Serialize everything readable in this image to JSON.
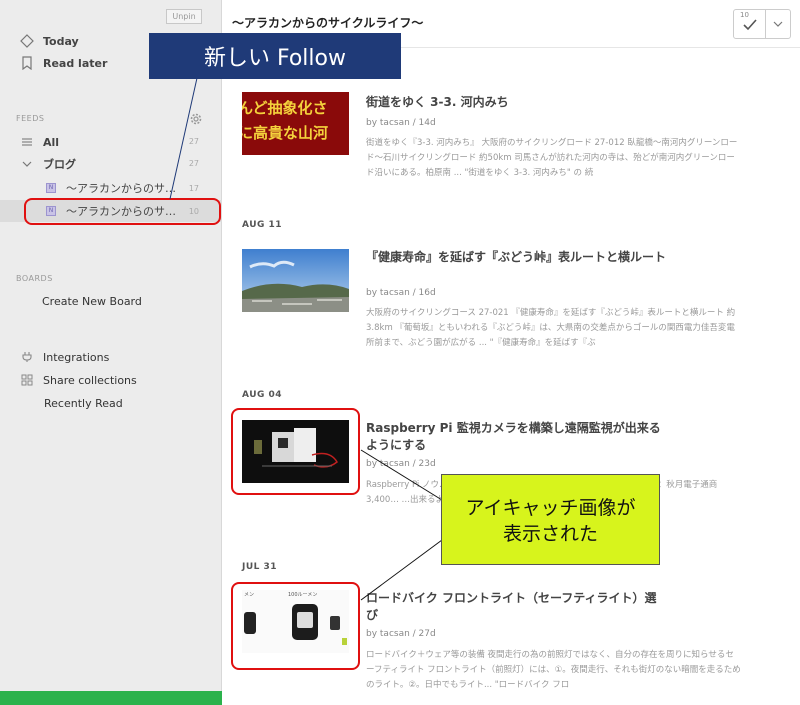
{
  "sidebar": {
    "unpin_label": "Unpin",
    "nav": {
      "today": "Today",
      "read_later": "Read later"
    },
    "feeds_section": "FEEDS",
    "all": {
      "label": "All",
      "count": "27"
    },
    "category": {
      "label": "ブログ",
      "count": "27"
    },
    "feeds": [
      {
        "label": "～アラカンからのサ…",
        "count": "17"
      },
      {
        "label": "～アラカンからのサ…",
        "count": "10"
      }
    ],
    "boards_section": "BOARDS",
    "create_board": "Create New Board",
    "integrations": "Integrations",
    "share_collections": "Share collections",
    "recently_read": "Recently Read"
  },
  "header": {
    "title": "～アラカンからのサイクルライフ～",
    "mark_read_count": "10"
  },
  "articles": [
    {
      "date": "",
      "title": "街道をゆく 3-3. 河内みち",
      "meta": "by tacsan / 14d",
      "snippet": "街道をゆく『3-3. 河内みち』 大阪府のサイクリングロード 27-012 臥龍橋～南河内グリーンロード～石川サイクリングロード 約50km 司馬さんが訪れた河内の寺は、殆どが南河内グリーンロード沿いにある。柏原南 ... \"街道をゆく 3-3. 河内みち\" の 続",
      "thumb_text": "んど抽象化さ\nに高貴な山河"
    },
    {
      "date": "AUG 11",
      "title": "『健康寿命』を延ばす『ぶどう峠』表ルートと横ルート",
      "meta": "by tacsan / 16d",
      "snippet": "大阪府のサイクリングコース 27-021 『健康寿命』を延ばす『ぶどう峠』表ルートと横ルート 約 3.8km 『葡萄坂』ともいわれる『ぶどう峠』は、大県南の交差点からゴールの関西電力佳吾変電所前まで、ぶどう園が広がる ... \"『健康寿命』を延ばす『ぶ"
    },
    {
      "date": "AUG 04",
      "title": "Raspberry Pi 監視カメラを構築し遠隔監視が出来るようにする",
      "meta": "by tacsan / 23d",
      "snippet": "Raspberry Pi ノウ… …記録し、監視結果をWebで閲覧で… …ラモジュール：秋月電子通商 3,400… …出来るようにする"
    },
    {
      "date": "JUL 31",
      "title": "ロードバイク フロントライト（セーフティライト）選び",
      "meta": "by tacsan / 27d",
      "snippet": "ロードバイク＋ウェア等の装備 夜間走行の為の前照灯ではなく、自分の存在を周りに知らせるセーフティライト フロントライト（前照灯）には、①。夜間走行、それも街灯のない暗闇を走るためのライト。②。日中でもライト... \"ロードバイク フロ",
      "thumb_labels": {
        "left": "メン",
        "mid": "100ルーメン"
      }
    }
  ],
  "annotations": {
    "new_follow": "新しい Follow",
    "eyecatch_line1": "アイキャッチ画像が",
    "eyecatch_line2": "表示された"
  },
  "colors": {
    "annotation_red": "#e01010",
    "callout_blue": "#1f3a78",
    "callout_green": "#d7f41c",
    "feedly_green": "#2bb24c"
  }
}
